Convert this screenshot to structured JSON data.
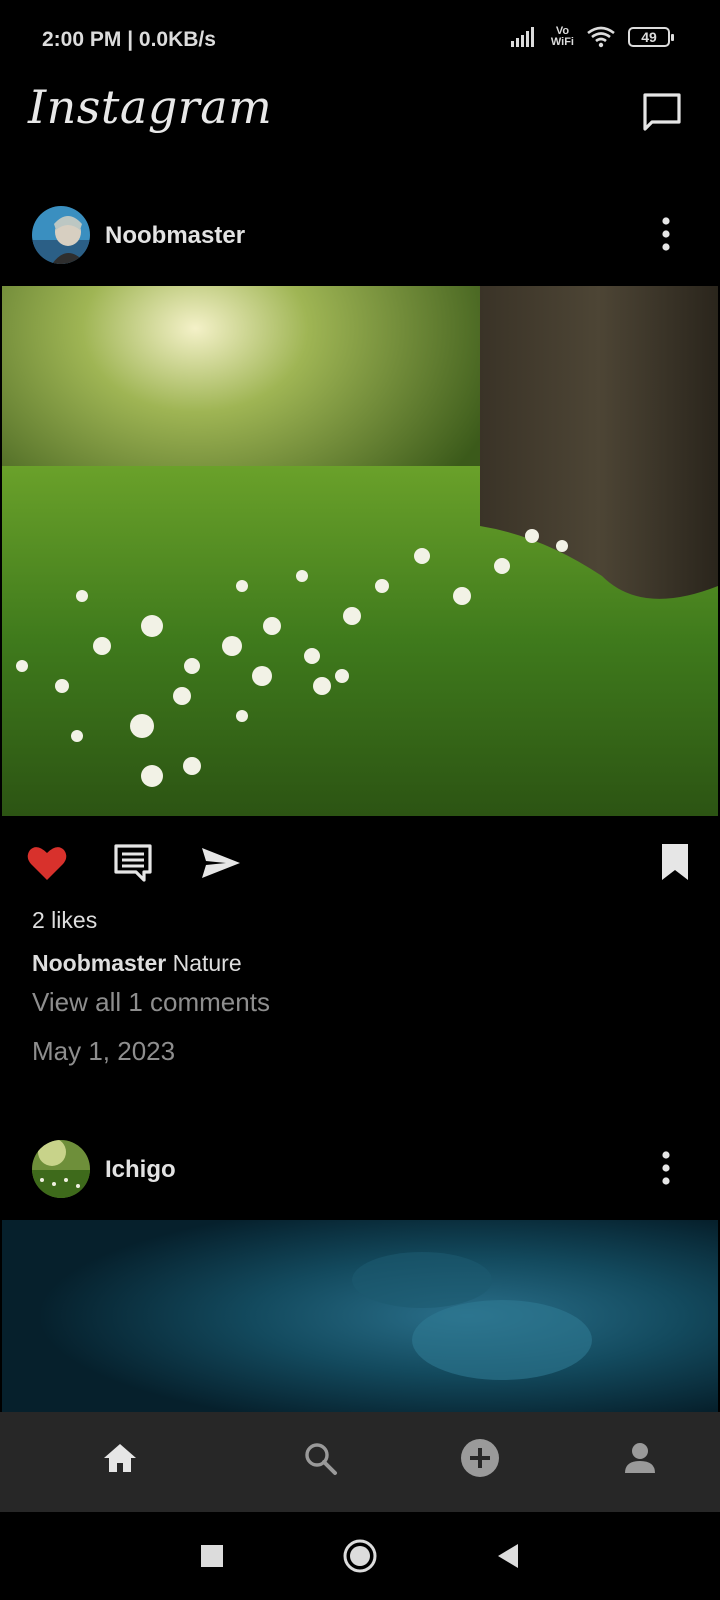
{
  "status_bar": {
    "time": "2:00 PM | 0.0KB/s",
    "vowifi_top": "Vo",
    "vowifi_bottom": "WiFi",
    "battery": "49"
  },
  "header": {
    "logo": "Instagram",
    "dm_icon": "message-icon"
  },
  "posts": [
    {
      "username": "Noobmaster",
      "likes": "2 likes",
      "caption_user": "Noobmaster",
      "caption_text": "Nature",
      "comments_link": "View all 1 comments",
      "date": "May 1, 2023",
      "liked": true
    },
    {
      "username": "Ichigo"
    }
  ],
  "bottom_nav": [
    "home-icon",
    "search-icon",
    "add-post-icon",
    "profile-icon"
  ],
  "colors": {
    "like_red": "#d8312c",
    "background": "#000000",
    "nav_bg": "#272727",
    "muted_text": "#8e8e8e"
  }
}
